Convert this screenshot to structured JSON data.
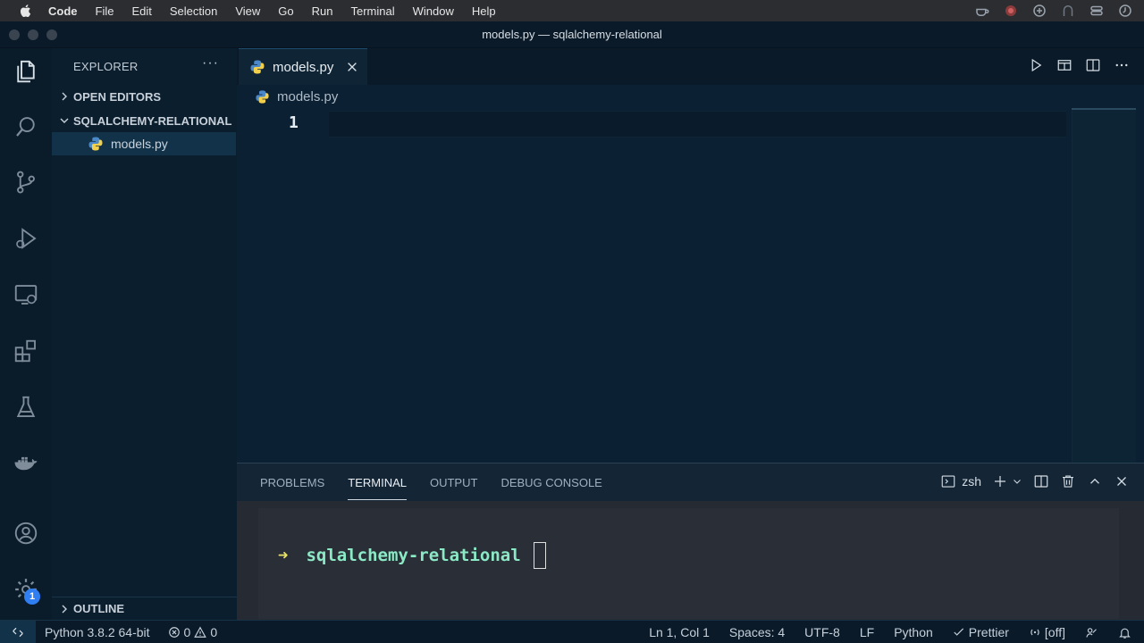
{
  "menubar": {
    "app_name": "Code",
    "items": [
      "File",
      "Edit",
      "Selection",
      "View",
      "Go",
      "Run",
      "Terminal",
      "Window",
      "Help"
    ]
  },
  "window": {
    "title": "models.py — sqlalchemy-relational"
  },
  "activity_bar": {
    "items": [
      "explorer-icon",
      "search-icon",
      "source-control-icon",
      "run-debug-icon",
      "remote-explorer-icon",
      "extensions-icon",
      "testing-icon",
      "docker-icon",
      "account-icon",
      "manage-gear-icon"
    ],
    "manage_badge": "1"
  },
  "sidebar": {
    "header": "EXPLORER",
    "more": "···",
    "open_editors": "OPEN EDITORS",
    "folder": "SQLALCHEMY-RELATIONAL",
    "files": [
      {
        "name": "models.py"
      }
    ],
    "outline": "OUTLINE"
  },
  "editor": {
    "tab": {
      "label": "models.py"
    },
    "breadcrumb": "models.py",
    "lines": [
      "1"
    ]
  },
  "panel": {
    "tabs": [
      "PROBLEMS",
      "TERMINAL",
      "OUTPUT",
      "DEBUG CONSOLE"
    ],
    "active_tab": "TERMINAL",
    "shell": "zsh",
    "terminal": {
      "prompt_symbol": "➜",
      "cwd": "sqlalchemy-relational"
    }
  },
  "statusbar": {
    "interpreter": "Python 3.8.2 64-bit",
    "errors": "0",
    "warnings": "0",
    "position": "Ln 1, Col 1",
    "indent": "Spaces: 4",
    "encoding": "UTF-8",
    "eol": "LF",
    "language": "Python",
    "formatter": "Prettier",
    "live_share": "[off]"
  },
  "colors": {
    "editor_bg": "#0b2032",
    "sidebar_bg": "#0b1e2e",
    "terminal_bg": "#262a33",
    "prompt_arrow": "#e8e26a",
    "prompt_dir": "#8ce9c6",
    "badge": "#2f7ef2"
  }
}
